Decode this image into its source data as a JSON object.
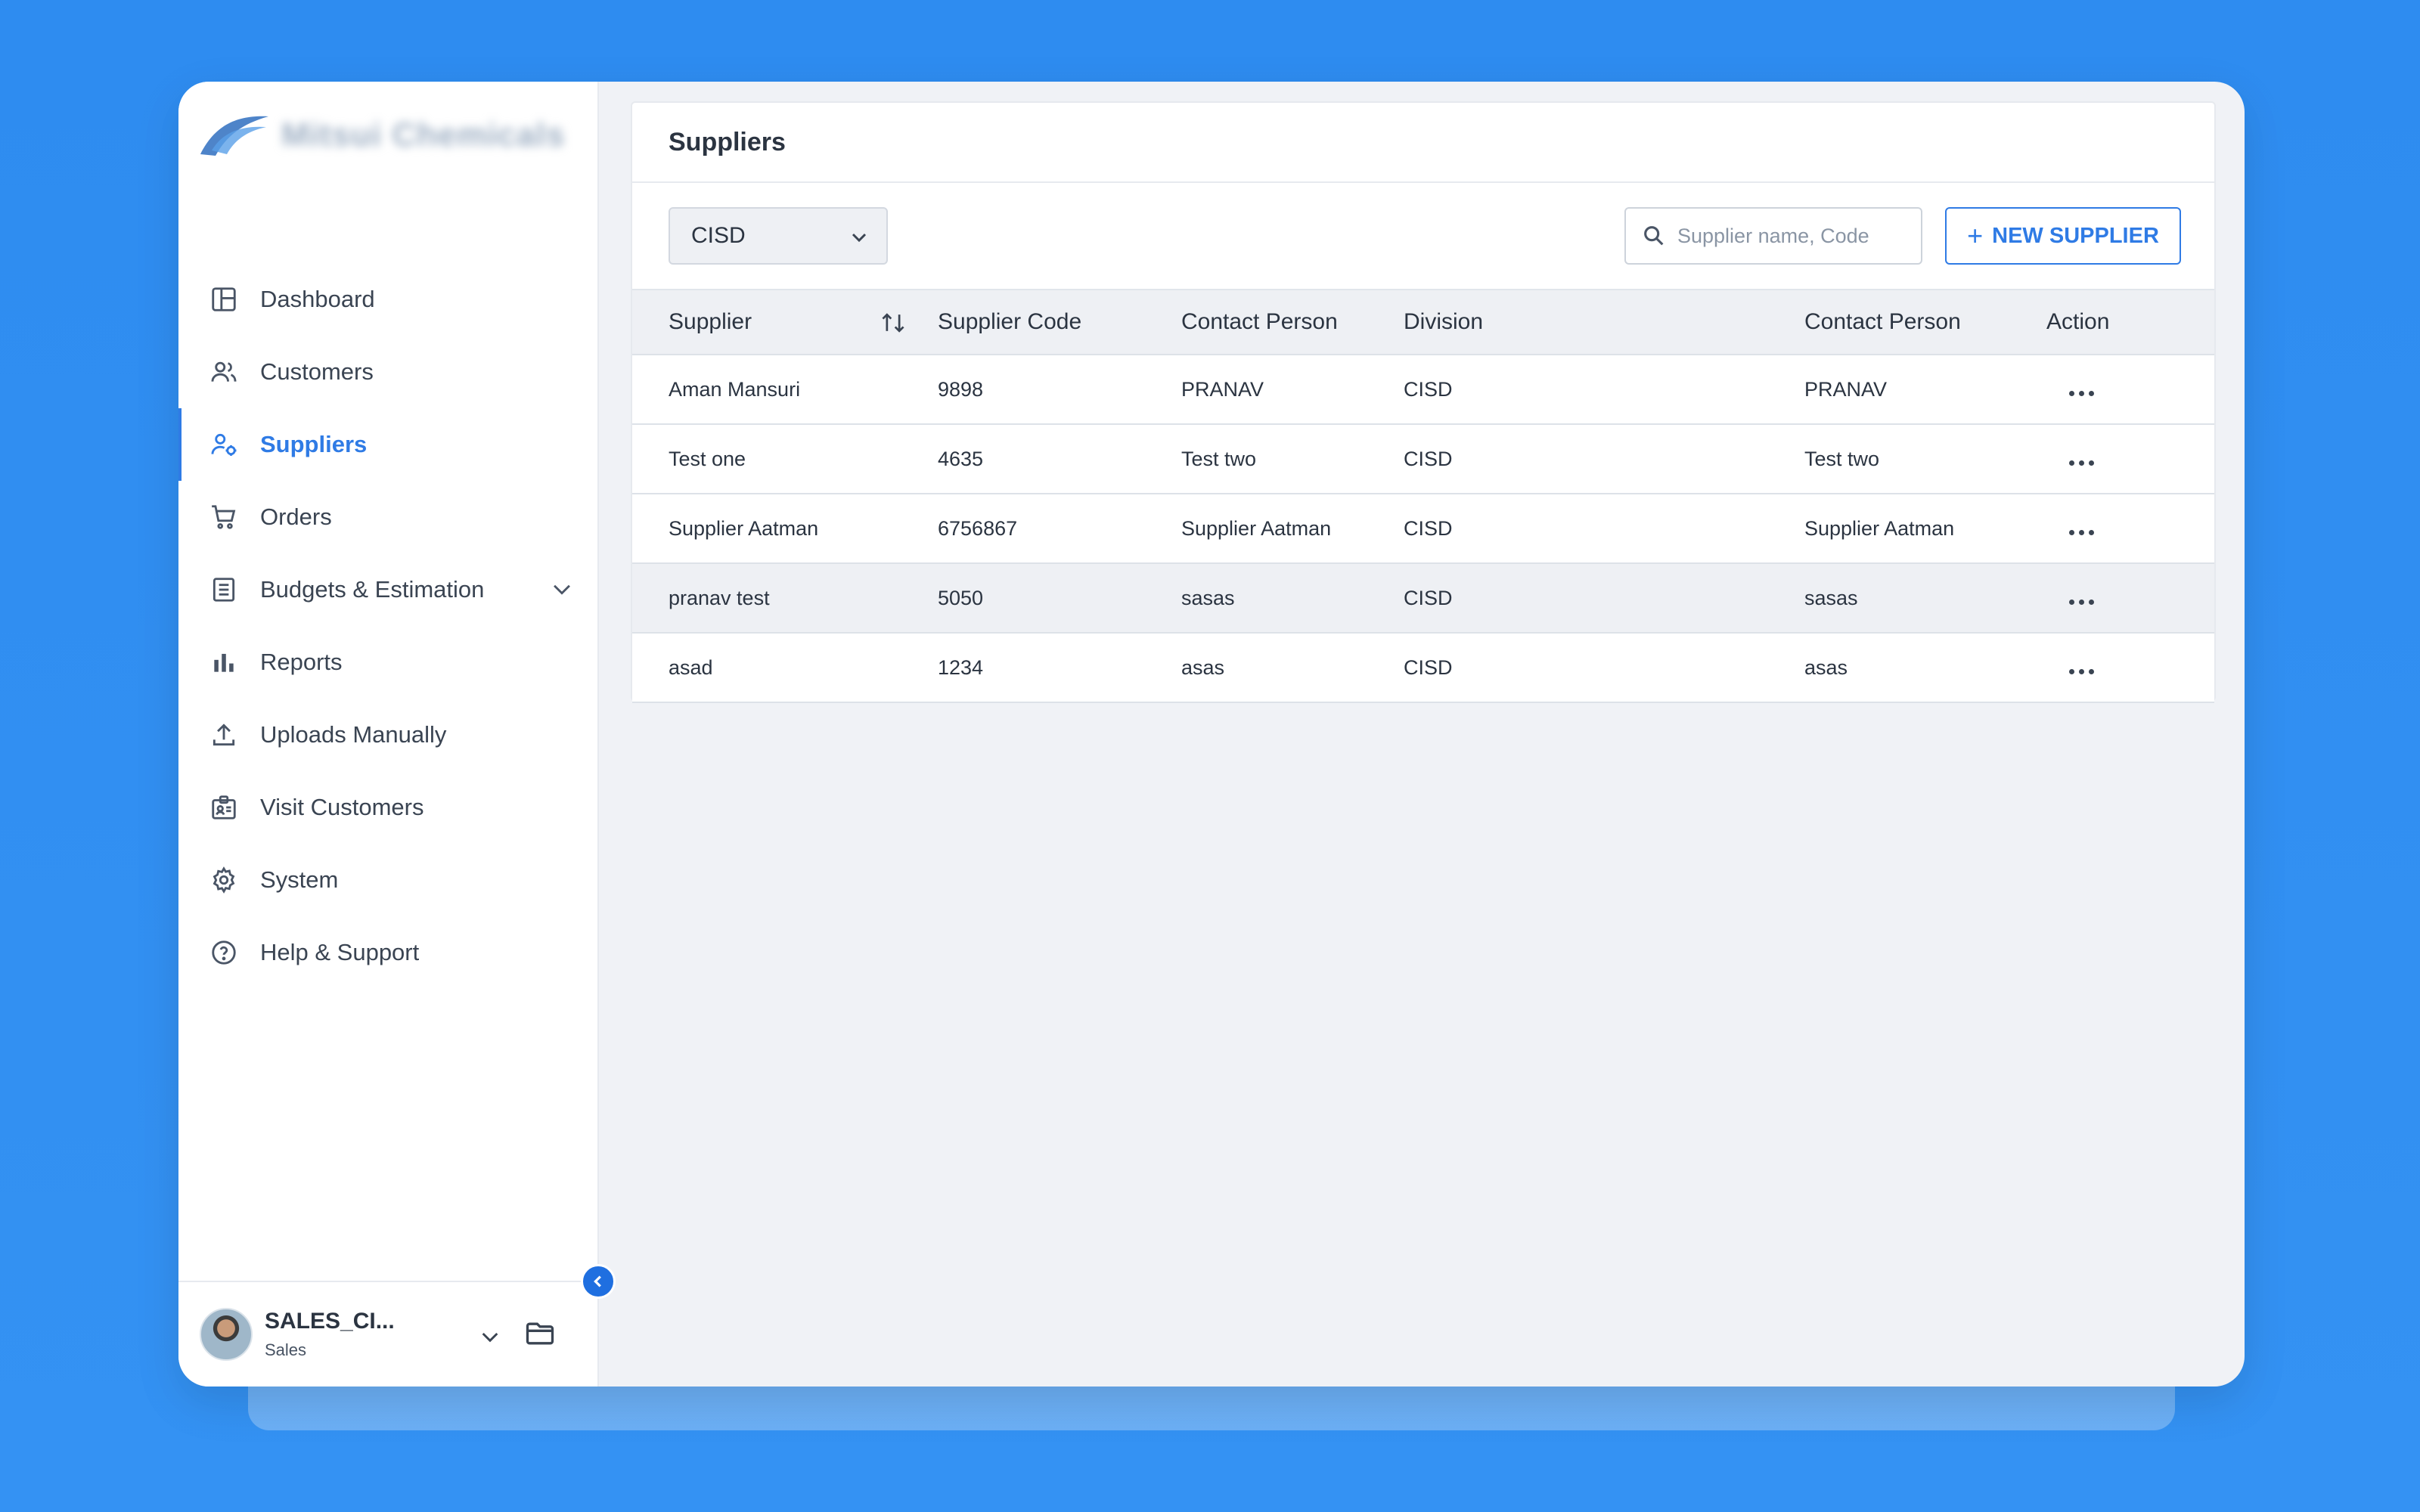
{
  "brand": {
    "name": "Mitsui Chemicals"
  },
  "sidebar": {
    "items": [
      {
        "label": "Dashboard",
        "icon": "dashboard-icon"
      },
      {
        "label": "Customers",
        "icon": "users-icon"
      },
      {
        "label": "Suppliers",
        "icon": "supplier-icon",
        "active": true
      },
      {
        "label": "Orders",
        "icon": "cart-icon"
      },
      {
        "label": "Budgets & Estimation",
        "icon": "document-icon",
        "expandable": true
      },
      {
        "label": "Reports",
        "icon": "bar-chart-icon"
      },
      {
        "label": "Uploads Manually",
        "icon": "upload-icon"
      },
      {
        "label": "Visit Customers",
        "icon": "badge-icon"
      },
      {
        "label": "System",
        "icon": "gear-icon"
      },
      {
        "label": "Help & Support",
        "icon": "help-icon"
      }
    ]
  },
  "user": {
    "name": "SALES_CI...",
    "role": "Sales"
  },
  "main": {
    "title": "Suppliers",
    "division_selected": "CISD",
    "search_placeholder": "Supplier name, Code",
    "new_button": "NEW SUPPLIER",
    "columns": [
      "Supplier",
      "Supplier Code",
      "Contact Person",
      "Division",
      "Contact Person",
      "Action"
    ],
    "rows": [
      {
        "supplier": "Aman Mansuri",
        "code": "9898",
        "contact": "PRANAV",
        "division": "CISD",
        "contact2": "PRANAV"
      },
      {
        "supplier": "Test one",
        "code": "4635",
        "contact": "Test two",
        "division": "CISD",
        "contact2": "Test two"
      },
      {
        "supplier": "Supplier Aatman",
        "code": "6756867",
        "contact": "Supplier Aatman",
        "division": "CISD",
        "contact2": "Supplier Aatman"
      },
      {
        "supplier": "pranav test",
        "code": "5050",
        "contact": "sasas",
        "division": "CISD",
        "contact2": "sasas"
      },
      {
        "supplier": "asad",
        "code": "1234",
        "contact": "asas",
        "division": "CISD",
        "contact2": "asas"
      }
    ]
  },
  "colors": {
    "accent": "#2f7be5",
    "background": "#3490f2",
    "header_bg": "#eef0f4"
  }
}
